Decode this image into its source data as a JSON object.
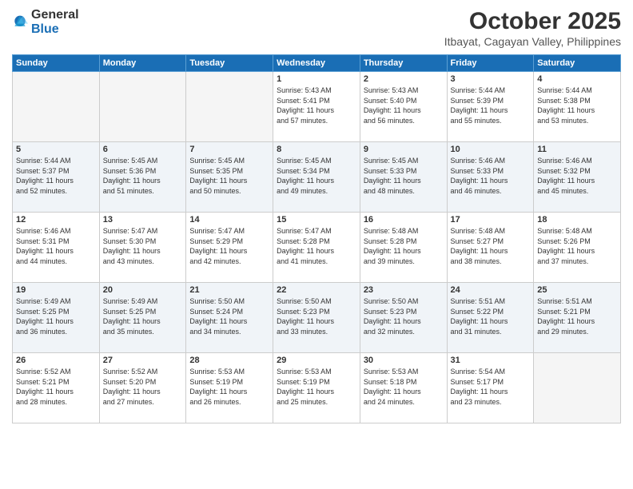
{
  "logo": {
    "general": "General",
    "blue": "Blue"
  },
  "title": "October 2025",
  "subtitle": "Itbayat, Cagayan Valley, Philippines",
  "weekdays": [
    "Sunday",
    "Monday",
    "Tuesday",
    "Wednesday",
    "Thursday",
    "Friday",
    "Saturday"
  ],
  "weeks": [
    [
      {
        "day": "",
        "info": ""
      },
      {
        "day": "",
        "info": ""
      },
      {
        "day": "",
        "info": ""
      },
      {
        "day": "1",
        "info": "Sunrise: 5:43 AM\nSunset: 5:41 PM\nDaylight: 11 hours\nand 57 minutes."
      },
      {
        "day": "2",
        "info": "Sunrise: 5:43 AM\nSunset: 5:40 PM\nDaylight: 11 hours\nand 56 minutes."
      },
      {
        "day": "3",
        "info": "Sunrise: 5:44 AM\nSunset: 5:39 PM\nDaylight: 11 hours\nand 55 minutes."
      },
      {
        "day": "4",
        "info": "Sunrise: 5:44 AM\nSunset: 5:38 PM\nDaylight: 11 hours\nand 53 minutes."
      }
    ],
    [
      {
        "day": "5",
        "info": "Sunrise: 5:44 AM\nSunset: 5:37 PM\nDaylight: 11 hours\nand 52 minutes."
      },
      {
        "day": "6",
        "info": "Sunrise: 5:45 AM\nSunset: 5:36 PM\nDaylight: 11 hours\nand 51 minutes."
      },
      {
        "day": "7",
        "info": "Sunrise: 5:45 AM\nSunset: 5:35 PM\nDaylight: 11 hours\nand 50 minutes."
      },
      {
        "day": "8",
        "info": "Sunrise: 5:45 AM\nSunset: 5:34 PM\nDaylight: 11 hours\nand 49 minutes."
      },
      {
        "day": "9",
        "info": "Sunrise: 5:45 AM\nSunset: 5:33 PM\nDaylight: 11 hours\nand 48 minutes."
      },
      {
        "day": "10",
        "info": "Sunrise: 5:46 AM\nSunset: 5:33 PM\nDaylight: 11 hours\nand 46 minutes."
      },
      {
        "day": "11",
        "info": "Sunrise: 5:46 AM\nSunset: 5:32 PM\nDaylight: 11 hours\nand 45 minutes."
      }
    ],
    [
      {
        "day": "12",
        "info": "Sunrise: 5:46 AM\nSunset: 5:31 PM\nDaylight: 11 hours\nand 44 minutes."
      },
      {
        "day": "13",
        "info": "Sunrise: 5:47 AM\nSunset: 5:30 PM\nDaylight: 11 hours\nand 43 minutes."
      },
      {
        "day": "14",
        "info": "Sunrise: 5:47 AM\nSunset: 5:29 PM\nDaylight: 11 hours\nand 42 minutes."
      },
      {
        "day": "15",
        "info": "Sunrise: 5:47 AM\nSunset: 5:28 PM\nDaylight: 11 hours\nand 41 minutes."
      },
      {
        "day": "16",
        "info": "Sunrise: 5:48 AM\nSunset: 5:28 PM\nDaylight: 11 hours\nand 39 minutes."
      },
      {
        "day": "17",
        "info": "Sunrise: 5:48 AM\nSunset: 5:27 PM\nDaylight: 11 hours\nand 38 minutes."
      },
      {
        "day": "18",
        "info": "Sunrise: 5:48 AM\nSunset: 5:26 PM\nDaylight: 11 hours\nand 37 minutes."
      }
    ],
    [
      {
        "day": "19",
        "info": "Sunrise: 5:49 AM\nSunset: 5:25 PM\nDaylight: 11 hours\nand 36 minutes."
      },
      {
        "day": "20",
        "info": "Sunrise: 5:49 AM\nSunset: 5:25 PM\nDaylight: 11 hours\nand 35 minutes."
      },
      {
        "day": "21",
        "info": "Sunrise: 5:50 AM\nSunset: 5:24 PM\nDaylight: 11 hours\nand 34 minutes."
      },
      {
        "day": "22",
        "info": "Sunrise: 5:50 AM\nSunset: 5:23 PM\nDaylight: 11 hours\nand 33 minutes."
      },
      {
        "day": "23",
        "info": "Sunrise: 5:50 AM\nSunset: 5:23 PM\nDaylight: 11 hours\nand 32 minutes."
      },
      {
        "day": "24",
        "info": "Sunrise: 5:51 AM\nSunset: 5:22 PM\nDaylight: 11 hours\nand 31 minutes."
      },
      {
        "day": "25",
        "info": "Sunrise: 5:51 AM\nSunset: 5:21 PM\nDaylight: 11 hours\nand 29 minutes."
      }
    ],
    [
      {
        "day": "26",
        "info": "Sunrise: 5:52 AM\nSunset: 5:21 PM\nDaylight: 11 hours\nand 28 minutes."
      },
      {
        "day": "27",
        "info": "Sunrise: 5:52 AM\nSunset: 5:20 PM\nDaylight: 11 hours\nand 27 minutes."
      },
      {
        "day": "28",
        "info": "Sunrise: 5:53 AM\nSunset: 5:19 PM\nDaylight: 11 hours\nand 26 minutes."
      },
      {
        "day": "29",
        "info": "Sunrise: 5:53 AM\nSunset: 5:19 PM\nDaylight: 11 hours\nand 25 minutes."
      },
      {
        "day": "30",
        "info": "Sunrise: 5:53 AM\nSunset: 5:18 PM\nDaylight: 11 hours\nand 24 minutes."
      },
      {
        "day": "31",
        "info": "Sunrise: 5:54 AM\nSunset: 5:17 PM\nDaylight: 11 hours\nand 23 minutes."
      },
      {
        "day": "",
        "info": ""
      }
    ]
  ]
}
